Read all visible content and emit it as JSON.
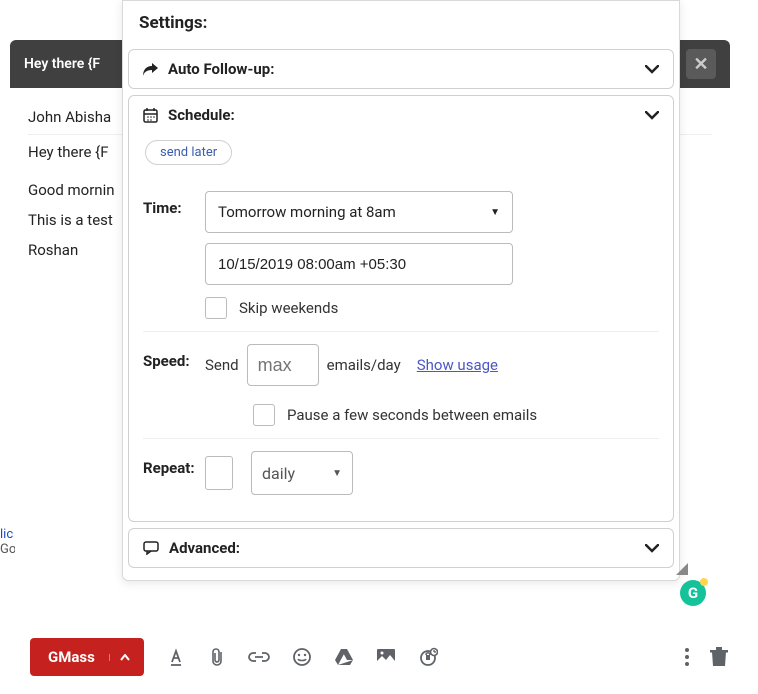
{
  "compose": {
    "subject": "Hey there {F",
    "to": "John Abisha",
    "body": {
      "line1": "Hey there {F",
      "line2": "Good mornin",
      "line3": "This is a test",
      "signature": "Roshan"
    },
    "close": "✕"
  },
  "settings": {
    "title": "Settings:",
    "sections": {
      "autofollowup": {
        "label": "Auto Follow-up:"
      },
      "schedule": {
        "label": "Schedule:",
        "pill": "send later",
        "time": {
          "label": "Time:",
          "preset": "Tomorrow morning at 8am",
          "datetime": "10/15/2019 08:00am +05:30",
          "skip_weekends": "Skip weekends"
        },
        "speed": {
          "label": "Speed:",
          "send_text": "Send",
          "placeholder": "max",
          "suffix": "emails/day",
          "show_usage": "Show usage",
          "pause_label": "Pause a few seconds between emails"
        },
        "repeat": {
          "label": "Repeat:",
          "unit": "daily"
        }
      },
      "advanced": {
        "label": "Advanced:"
      }
    }
  },
  "toolbar": {
    "gmass": "GMass"
  },
  "left_edge": {
    "l1": "lic",
    "l2": "Go"
  },
  "grammarly": "G"
}
